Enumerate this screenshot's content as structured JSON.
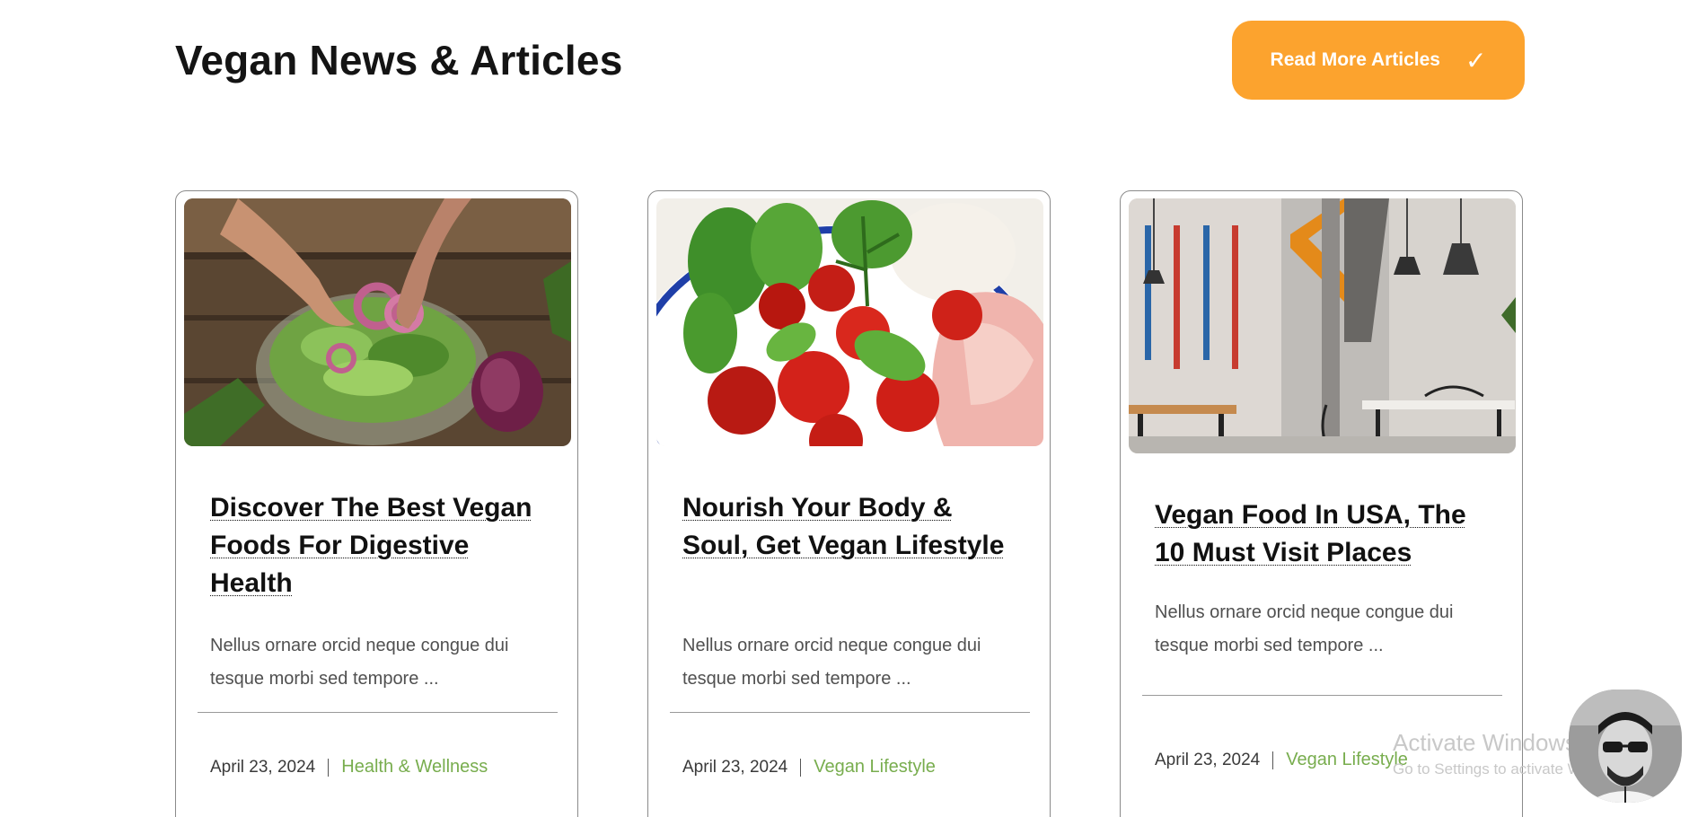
{
  "header": {
    "title": "Vegan News & Articles",
    "cta_label": "Read More Articles",
    "cta_icon": "checkmark-icon"
  },
  "colors": {
    "accent_orange": "#fca32e",
    "category_green": "#78ad4e",
    "title_dark": "#141414"
  },
  "articles": [
    {
      "title": "Discover The Best Vegan Foods For Digestive Health",
      "excerpt": "Nellus ornare orcid neque congue dui tesque morbi sed tempore ...",
      "date": "April 23, 2024",
      "category": "Health & Wellness",
      "image": "salad-bowl-with-onions-photo"
    },
    {
      "title": "Nourish Your Body & Soul, Get Vegan Lifestyle",
      "excerpt": "Nellus ornare orcid neque congue dui tesque morbi sed tempore ...",
      "date": "April 23, 2024",
      "category": "Vegan Lifestyle",
      "image": "tomatoes-basil-bowl-photo"
    },
    {
      "title": "Vegan Food In USA, The 10 Must Visit Places",
      "excerpt": "Nellus ornare orcid neque congue dui tesque morbi sed tempore ...",
      "date": "April 23, 2024",
      "category": "Vegan Lifestyle",
      "image": "restaurant-interior-photo"
    }
  ],
  "watermark": {
    "title": "Activate Windows",
    "subtitle": "Go to Settings to activate Windows."
  }
}
